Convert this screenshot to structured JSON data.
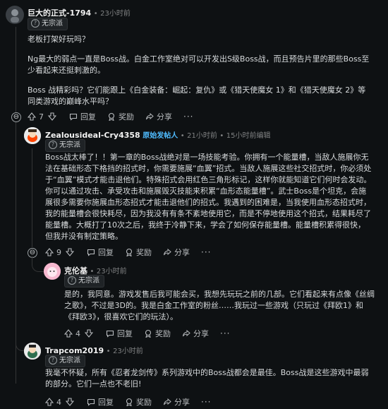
{
  "comments": [
    {
      "author": "巨大的正式-1794",
      "sep": "•",
      "time": "23小时前",
      "flair": "无宗派",
      "paragraphs": [
        "老板打架好玩吗？",
        "Ng最大的弱点一直是Boss战。白金工作室绝对可以开发出S级Boss战，而且预告片里的那些Boss至少看起来还挺刺激的。",
        "Boss 战精彩吗？它们能跟上《白金装备：崛起：复仇》或《猎天使魔女 1》和《猎天使魔女 2》等同类游戏的巅峰水平吗？"
      ],
      "votes": "7",
      "reply": "回复",
      "award": "奖励",
      "share": "分享",
      "more": "···"
    },
    {
      "author": "Zealousideal-Cry4358",
      "op_badge": "原始发帖人",
      "sep": "•",
      "time": "21小时前",
      "sep2": "•",
      "edited": "15小时前编辑",
      "flair": "无宗派",
      "paragraphs": [
        "Boss战太棒了！！第一章的Boss战绝对是一场技能考验。你拥有一个能量槽，当敌人施展你无法在基础形态下格挡的招式时，你需要施展“血翼”招式。当敌人施展这些社交招式时，你必须处于“血翼”模式才能击退他们。特殊招式会用红色三角形标记，这样你就能知道它们何时会发动。你可以通过攻击、承受攻击和施展毁灭技能来积累“血形态能量槽”。武士Boss是个坦克，会施展很多需要你施展血形态招式才能击退他们的招式。我遇到的困难是，当我使用血形态招式时，我的能量槽会很快耗尽，因为我没有有条不紊地使用它，而是不停地使用这个招式，结果耗尽了能量槽。大概打了10次之后，我终于冷静下来，学会了如何保存能量槽。能量槽积累得很快，但我并没有制定策略。"
      ],
      "votes": "9",
      "reply": "回复",
      "award": "奖励",
      "share": "分享",
      "more": "···"
    },
    {
      "author": "克伦基",
      "sep": "•",
      "time": "23小时前",
      "flair": "无宗派",
      "paragraphs": [
        "是的，我同意。游戏发售后我可能会买，我想先玩玩之前的几部。它们看起来有点像《丝绸之歌》，不过是3D的。我是白金工作室的粉丝……我玩过一些游戏（只玩过《拜欧1》和《拜欧3》，很喜欢它们的玩法）。"
      ],
      "votes": "4",
      "reply": "回复",
      "award": "奖励",
      "share": "分享",
      "more": "···"
    },
    {
      "author": "Trapcom2019",
      "sep": "•",
      "time": "23小时前",
      "flair": "无宗派",
      "paragraphs": [
        "我毫不怀疑，所有《忍者龙剑传》系列游戏中的Boss战都会是最佳。Boss战是这些游戏中最弱的部分。它们一点也不老旧!"
      ],
      "votes": "4",
      "reply": "回复",
      "award": "奖励",
      "share": "分享",
      "more": "···"
    }
  ],
  "collapse_symbol": "⊖",
  "flair_icon": "?",
  "colors": {
    "background": "#0e1113",
    "text": "#d7dadc",
    "meta": "#818384",
    "op": "#4fbcff",
    "thread_line": "#343536"
  },
  "icons": [
    "upvote-icon",
    "downvote-icon",
    "reply-icon",
    "award-icon",
    "share-icon",
    "more-icon",
    "collapse-icon",
    "help-icon"
  ]
}
